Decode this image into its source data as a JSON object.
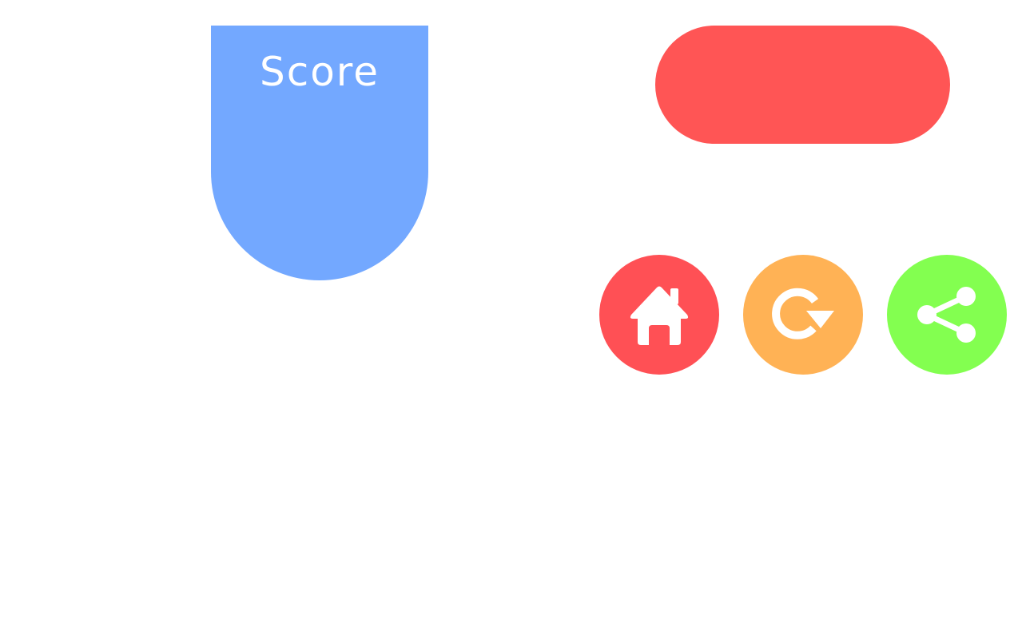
{
  "score_panel": {
    "label": "Score",
    "color": "#73a8ff"
  },
  "top_pill": {
    "color": "#ff5555"
  },
  "buttons": [
    {
      "name": "home",
      "icon": "home-icon",
      "color": "#ff5055"
    },
    {
      "name": "restart",
      "icon": "restart-icon",
      "color": "#ffb255"
    },
    {
      "name": "share",
      "icon": "share-icon",
      "color": "#83ff50"
    }
  ]
}
